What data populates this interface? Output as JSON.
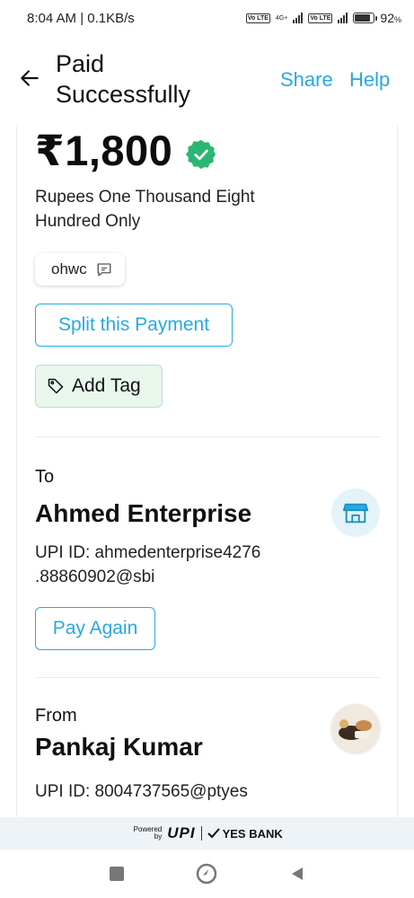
{
  "status_bar": {
    "time_speed": "8:04 AM | 0.1KB/s",
    "network_1": "4G+",
    "volte": "Vo LTE",
    "battery_percent": "92",
    "battery_level": 0.92,
    "icons": [
      "volte-icon",
      "signal-icon",
      "volte-icon",
      "signal-icon",
      "battery-icon"
    ]
  },
  "header": {
    "title": "Paid Successfully",
    "share_label": "Share",
    "help_label": "Help",
    "back_icon": "arrow-left-icon"
  },
  "payment": {
    "amount": "₹1,800",
    "amount_words": "Rupees One Thousand Eight Hundred Only",
    "note": "ohwc",
    "split_label": "Split this Payment",
    "tag_label": "Add Tag",
    "verified_icon": "verified-check-icon"
  },
  "to": {
    "label": "To",
    "name": "Ahmed Enterprise",
    "upi_id": "UPI ID: ahmedenterprise4276 .88860902@sbi",
    "pay_again_label": "Pay Again",
    "icon": "store-icon"
  },
  "from": {
    "label": "From",
    "name": "Pankaj Kumar",
    "upi_id": "UPI ID: 8004737565@ptyes",
    "avatar": "profile-photo"
  },
  "footer": {
    "powered_by": "Powered by",
    "upi": "UPI",
    "bank": "YES BANK"
  },
  "colors": {
    "accent": "#27a9e0",
    "verified_green": "#2bb673",
    "tag_bg": "#e8f6ec"
  }
}
